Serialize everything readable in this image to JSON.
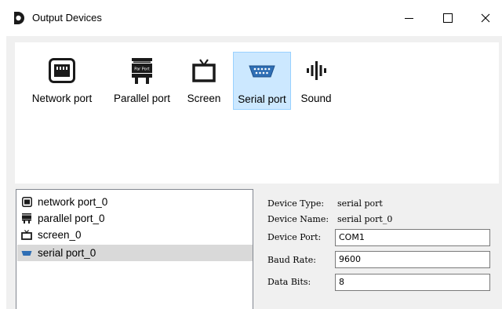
{
  "window": {
    "title": "Output Devices",
    "app_icon": "app-logo-icon",
    "controls": {
      "minimize": "minimize-icon",
      "maximize": "maximize-icon",
      "close": "close-icon"
    }
  },
  "toolbar": {
    "items": [
      {
        "label": "Network port",
        "icon": "network-port-icon",
        "selected": false
      },
      {
        "label": "Parallel port",
        "icon": "parallel-port-icon",
        "icon_text": "Par Port",
        "selected": false
      },
      {
        "label": "Screen",
        "icon": "screen-icon",
        "selected": false
      },
      {
        "label": "Serial port",
        "icon": "serial-port-icon",
        "selected": true
      },
      {
        "label": "Sound",
        "icon": "sound-icon",
        "selected": false
      }
    ]
  },
  "device_list": {
    "items": [
      {
        "label": "network port_0",
        "icon": "network-port-icon",
        "selected": false
      },
      {
        "label": "parallel port_0",
        "icon": "parallel-port-icon",
        "selected": false
      },
      {
        "label": "screen_0",
        "icon": "screen-icon",
        "selected": false
      },
      {
        "label": "serial port_0",
        "icon": "serial-port-icon",
        "selected": true
      }
    ]
  },
  "properties": {
    "device_type": {
      "label": "Device Type:",
      "value": "serial port"
    },
    "device_name": {
      "label": "Device Name:",
      "value": "serial port_0"
    },
    "device_port": {
      "label": "Device Port:",
      "value": "COM1"
    },
    "baud_rate": {
      "label": "Baud Rate:",
      "value": "9600"
    },
    "data_bits": {
      "label": "Data Bits:",
      "value": "8"
    }
  },
  "colors": {
    "selection_bg": "#cce8ff",
    "selection_border": "#99d1ff",
    "list_selection_bg": "#d9d9d9",
    "frame_bg": "#f0f0f0",
    "icon_dark": "#1a1a1a",
    "serial_icon_blue": "#2f6fb5"
  }
}
